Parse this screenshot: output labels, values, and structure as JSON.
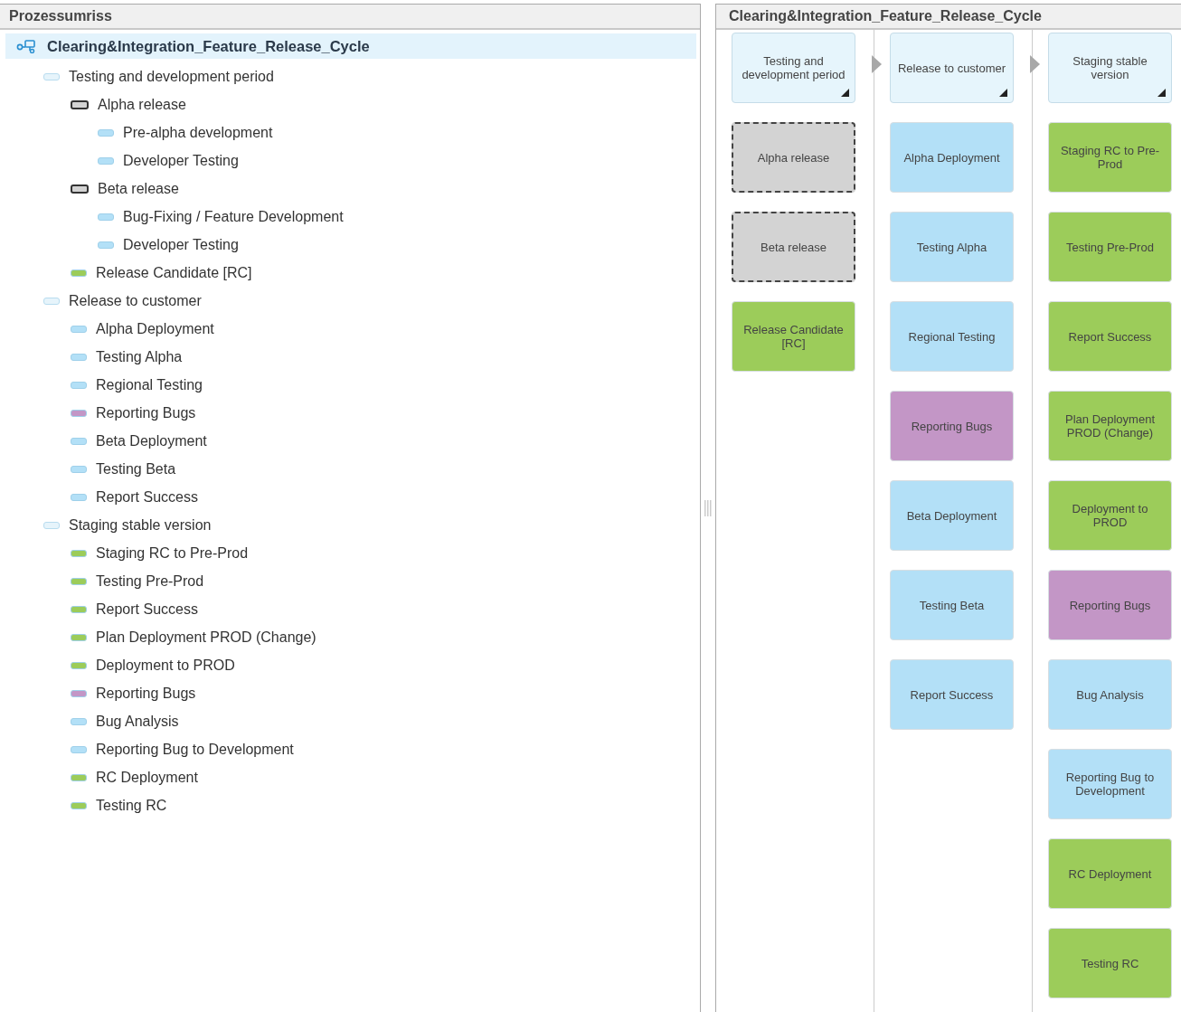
{
  "outline_panel": {
    "title": "Prozessumriss",
    "tree": [
      {
        "label": "Clearing&Integration_Feature_Release_Cycle",
        "kind": "process",
        "selected": true,
        "children": [
          {
            "label": "Testing and development period",
            "kind": "group",
            "color": "#e6f4fb",
            "selected": false,
            "children": [
              {
                "label": "Alpha release",
                "kind": "milestone",
                "color": "#d3d3d3",
                "selected": false,
                "children": [
                  {
                    "label": "Pre-alpha development",
                    "kind": "task",
                    "color": "#b3e0f7",
                    "selected": false
                  },
                  {
                    "label": "Developer Testing",
                    "kind": "task",
                    "color": "#b3e0f7",
                    "selected": false
                  }
                ]
              },
              {
                "label": "Beta release",
                "kind": "milestone",
                "color": "#d3d3d3",
                "selected": false,
                "children": [
                  {
                    "label": "Bug-Fixing / Feature Development",
                    "kind": "task",
                    "color": "#b3e0f7",
                    "selected": false
                  },
                  {
                    "label": "Developer Testing",
                    "kind": "task",
                    "color": "#b3e0f7",
                    "selected": false
                  }
                ]
              },
              {
                "label": "Release Candidate [RC]",
                "kind": "task",
                "color": "#9ccc5a",
                "selected": false
              }
            ]
          },
          {
            "label": "Release to customer",
            "kind": "group",
            "color": "#e6f4fb",
            "selected": false,
            "children": [
              {
                "label": "Alpha Deployment",
                "kind": "task",
                "color": "#b3e0f7",
                "selected": false
              },
              {
                "label": "Testing Alpha",
                "kind": "task",
                "color": "#b3e0f7",
                "selected": false
              },
              {
                "label": "Regional Testing",
                "kind": "task",
                "color": "#b3e0f7",
                "selected": false
              },
              {
                "label": "Reporting Bugs",
                "kind": "task",
                "color": "#c396c6",
                "selected": false
              },
              {
                "label": "Beta Deployment",
                "kind": "task",
                "color": "#b3e0f7",
                "selected": false
              },
              {
                "label": "Testing Beta",
                "kind": "task",
                "color": "#b3e0f7",
                "selected": false
              },
              {
                "label": "Report Success",
                "kind": "task",
                "color": "#b3e0f7",
                "selected": false
              }
            ]
          },
          {
            "label": "Staging stable version",
            "kind": "group",
            "color": "#e6f4fb",
            "selected": false,
            "children": [
              {
                "label": "Staging RC to Pre-Prod",
                "kind": "task",
                "color": "#9ccc5a",
                "selected": false
              },
              {
                "label": "Testing Pre-Prod",
                "kind": "task",
                "color": "#9ccc5a",
                "selected": false
              },
              {
                "label": "Report Success",
                "kind": "task",
                "color": "#9ccc5a",
                "selected": false
              },
              {
                "label": "Plan Deployment PROD (Change)",
                "kind": "task",
                "color": "#9ccc5a",
                "selected": false
              },
              {
                "label": "Deployment to PROD",
                "kind": "task",
                "color": "#9ccc5a",
                "selected": false
              },
              {
                "label": "Reporting Bugs",
                "kind": "task",
                "color": "#c396c6",
                "selected": false
              },
              {
                "label": "Bug Analysis",
                "kind": "task",
                "color": "#b3e0f7",
                "selected": false
              },
              {
                "label": "Reporting Bug to Development",
                "kind": "task",
                "color": "#b3e0f7",
                "selected": false
              },
              {
                "label": "RC Deployment",
                "kind": "task",
                "color": "#9ccc5a",
                "selected": false
              },
              {
                "label": "Testing RC",
                "kind": "task",
                "color": "#9ccc5a",
                "selected": false
              }
            ]
          }
        ]
      }
    ]
  },
  "diagram_panel": {
    "title": "Clearing&Integration_Feature_Release_Cycle",
    "columns": [
      {
        "header": "Testing and development period",
        "cards": [
          {
            "label": "Alpha release",
            "kind": "milestone",
            "color": "#d3d3d3"
          },
          {
            "label": "Beta release",
            "kind": "milestone",
            "color": "#d3d3d3"
          },
          {
            "label": "Release Candidate [RC]",
            "kind": "task",
            "color": "#9ccc5a"
          }
        ]
      },
      {
        "header": "Release to customer",
        "cards": [
          {
            "label": "Alpha Deployment",
            "kind": "task",
            "color": "#b3e0f7"
          },
          {
            "label": "Testing Alpha",
            "kind": "task",
            "color": "#b3e0f7"
          },
          {
            "label": "Regional Testing",
            "kind": "task",
            "color": "#b3e0f7"
          },
          {
            "label": "Reporting Bugs",
            "kind": "task",
            "color": "#c396c6"
          },
          {
            "label": "Beta Deployment",
            "kind": "task",
            "color": "#b3e0f7"
          },
          {
            "label": "Testing Beta",
            "kind": "task",
            "color": "#b3e0f7"
          },
          {
            "label": "Report Success",
            "kind": "task",
            "color": "#b3e0f7"
          }
        ]
      },
      {
        "header": "Staging stable version",
        "cards": [
          {
            "label": "Staging RC to Pre-Prod",
            "kind": "task",
            "color": "#9ccc5a"
          },
          {
            "label": "Testing Pre-Prod",
            "kind": "task",
            "color": "#9ccc5a"
          },
          {
            "label": "Report Success",
            "kind": "task",
            "color": "#9ccc5a"
          },
          {
            "label": "Plan Deployment PROD (Change)",
            "kind": "task",
            "color": "#9ccc5a"
          },
          {
            "label": "Deployment to PROD",
            "kind": "task",
            "color": "#9ccc5a"
          },
          {
            "label": "Reporting Bugs",
            "kind": "task",
            "color": "#c396c6"
          },
          {
            "label": "Bug Analysis",
            "kind": "task",
            "color": "#b3e0f7"
          },
          {
            "label": "Reporting Bug to Development",
            "kind": "task",
            "color": "#b3e0f7"
          },
          {
            "label": "RC Deployment",
            "kind": "task",
            "color": "#9ccc5a"
          },
          {
            "label": "Testing RC",
            "kind": "task",
            "color": "#9ccc5a"
          }
        ]
      }
    ]
  }
}
